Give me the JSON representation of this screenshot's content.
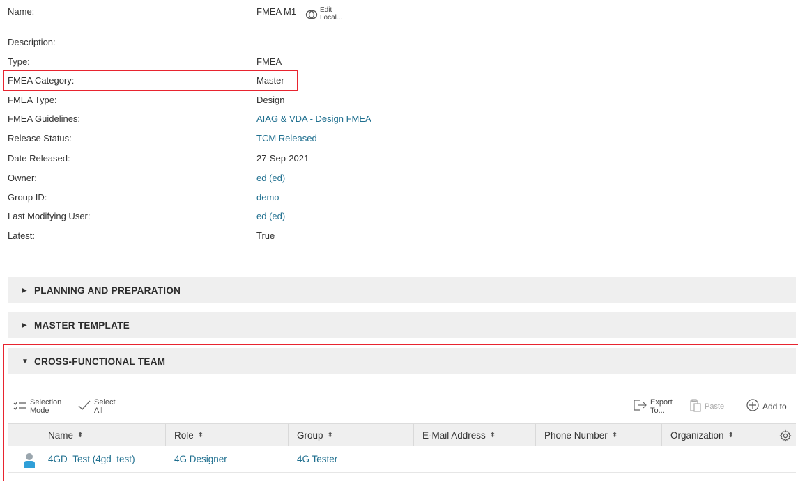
{
  "properties": [
    {
      "label": "Name:",
      "value": "FMEA M1",
      "link": false
    },
    {
      "label": "Description:",
      "value": "",
      "link": false
    },
    {
      "label": "Type:",
      "value": "FMEA",
      "link": false
    },
    {
      "label": "FMEA Category:",
      "value": "Master",
      "link": false
    },
    {
      "label": "FMEA Type:",
      "value": "Design",
      "link": false
    },
    {
      "label": "FMEA Guidelines:",
      "value": "AIAG & VDA - Design FMEA",
      "link": true
    },
    {
      "label": "Release Status:",
      "value": "TCM Released",
      "link": true
    },
    {
      "label": "Date Released:",
      "value": "27-Sep-2021",
      "link": false
    },
    {
      "label": "Owner:",
      "value": "ed (ed)",
      "link": true
    },
    {
      "label": "Group ID:",
      "value": "demo",
      "link": true
    },
    {
      "label": "Last Modifying User:",
      "value": "ed (ed)",
      "link": true
    },
    {
      "label": "Latest:",
      "value": "True",
      "link": false
    }
  ],
  "edit_local": {
    "line1": "Edit",
    "line2": "Local...",
    "icon": "edit-local-icon"
  },
  "panels": {
    "planning": "PLANNING AND PREPARATION",
    "master_template": "MASTER TEMPLATE",
    "cross_functional": "CROSS-FUNCTIONAL TEAM"
  },
  "toolbar": {
    "selection_mode": {
      "line1": "Selection",
      "line2": "Mode"
    },
    "select_all": {
      "line1": "Select",
      "line2": "All"
    },
    "export_to": {
      "line1": "Export",
      "line2": "To..."
    },
    "paste": "Paste",
    "add_to": "Add to"
  },
  "table": {
    "columns": [
      "Name",
      "Role",
      "Group",
      "E-Mail Address",
      "Phone Number",
      "Organization"
    ],
    "rows": [
      {
        "name": "4GD_Test (4gd_test)",
        "role": "4G Designer",
        "group": "4G Tester",
        "email": "",
        "phone": "",
        "organization": ""
      }
    ]
  },
  "colors": {
    "highlight": "#e8242f",
    "link": "#1f6f8f",
    "panel_bg": "#efefef"
  }
}
